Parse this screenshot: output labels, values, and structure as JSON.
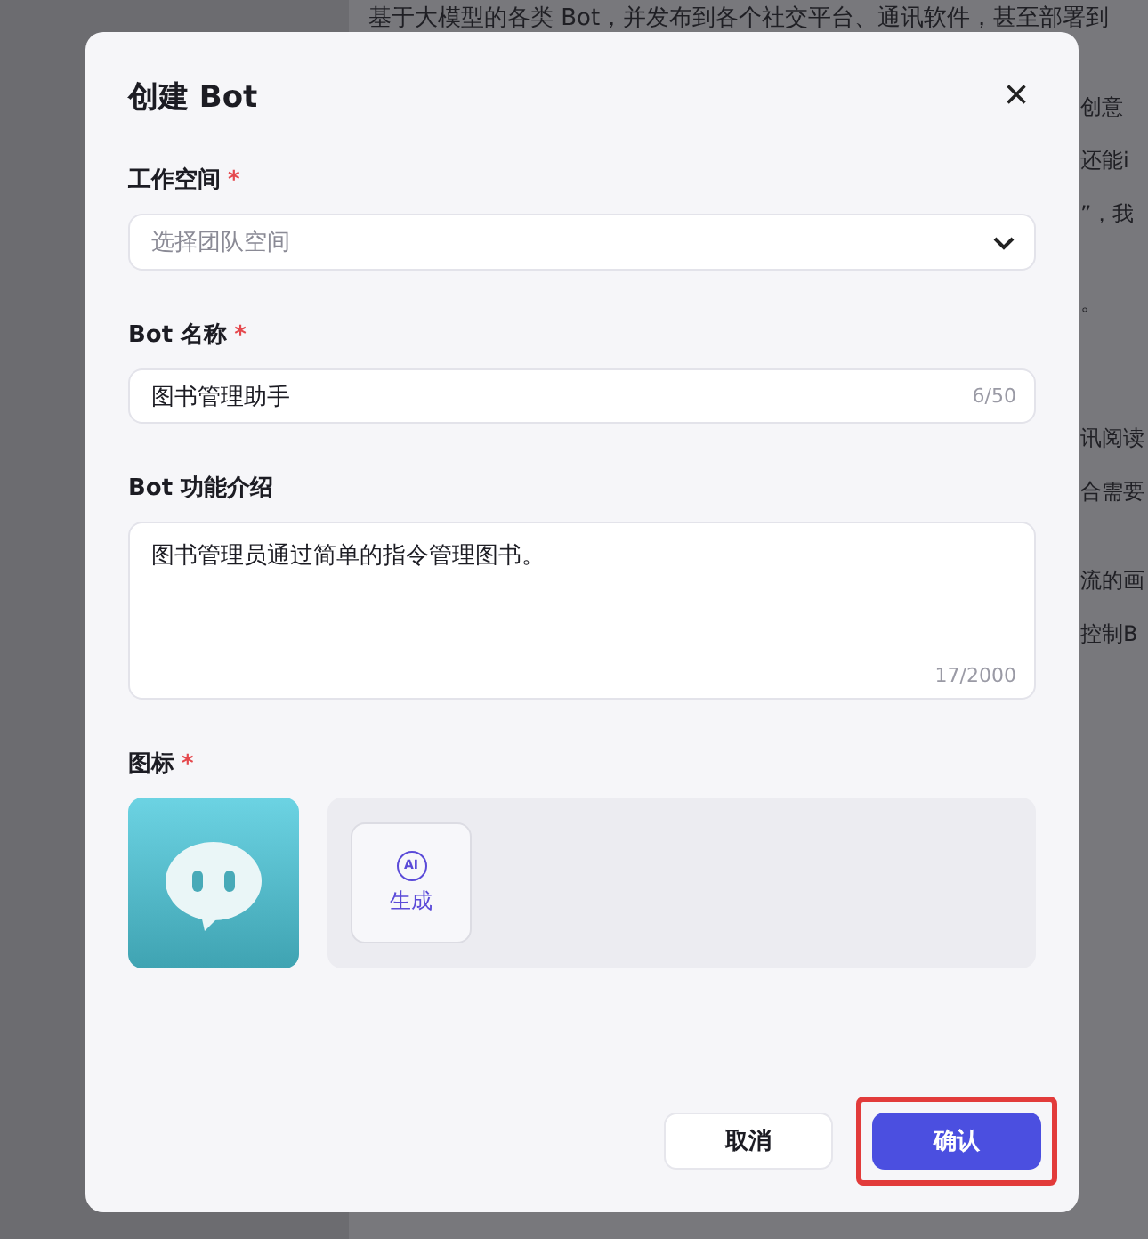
{
  "background": {
    "top_line": "基于大模型的各类 Bot，并发布到各个社交平台、通讯软件，甚至部署到",
    "fragments": [
      "创意",
      "还能i",
      "”，我",
      "。",
      "讯阅读",
      "合需要",
      "流的画",
      "控制B"
    ]
  },
  "dialog": {
    "title": "创建 Bot",
    "close": "×",
    "fields": [
      {
        "kind": "select",
        "label": "工作空间",
        "required_mark": "*",
        "placeholder": "选择团队空间"
      },
      {
        "kind": "input",
        "label": "Bot 名称",
        "required_mark": "*",
        "value": "图书管理助手",
        "counter": "6/50"
      },
      {
        "kind": "textarea",
        "label": "Bot 功能介绍",
        "value": "图书管理员通过简单的指令管理图书。",
        "counter": "17/2000"
      },
      {
        "kind": "icon",
        "label": "图标",
        "required_mark": "*",
        "generate": {
          "badge": "AI",
          "label": "生成"
        }
      }
    ],
    "buttons": [
      {
        "label": "取消",
        "primary": false,
        "highlighted": false
      },
      {
        "label": "确认",
        "primary": true,
        "highlighted": true
      }
    ]
  }
}
